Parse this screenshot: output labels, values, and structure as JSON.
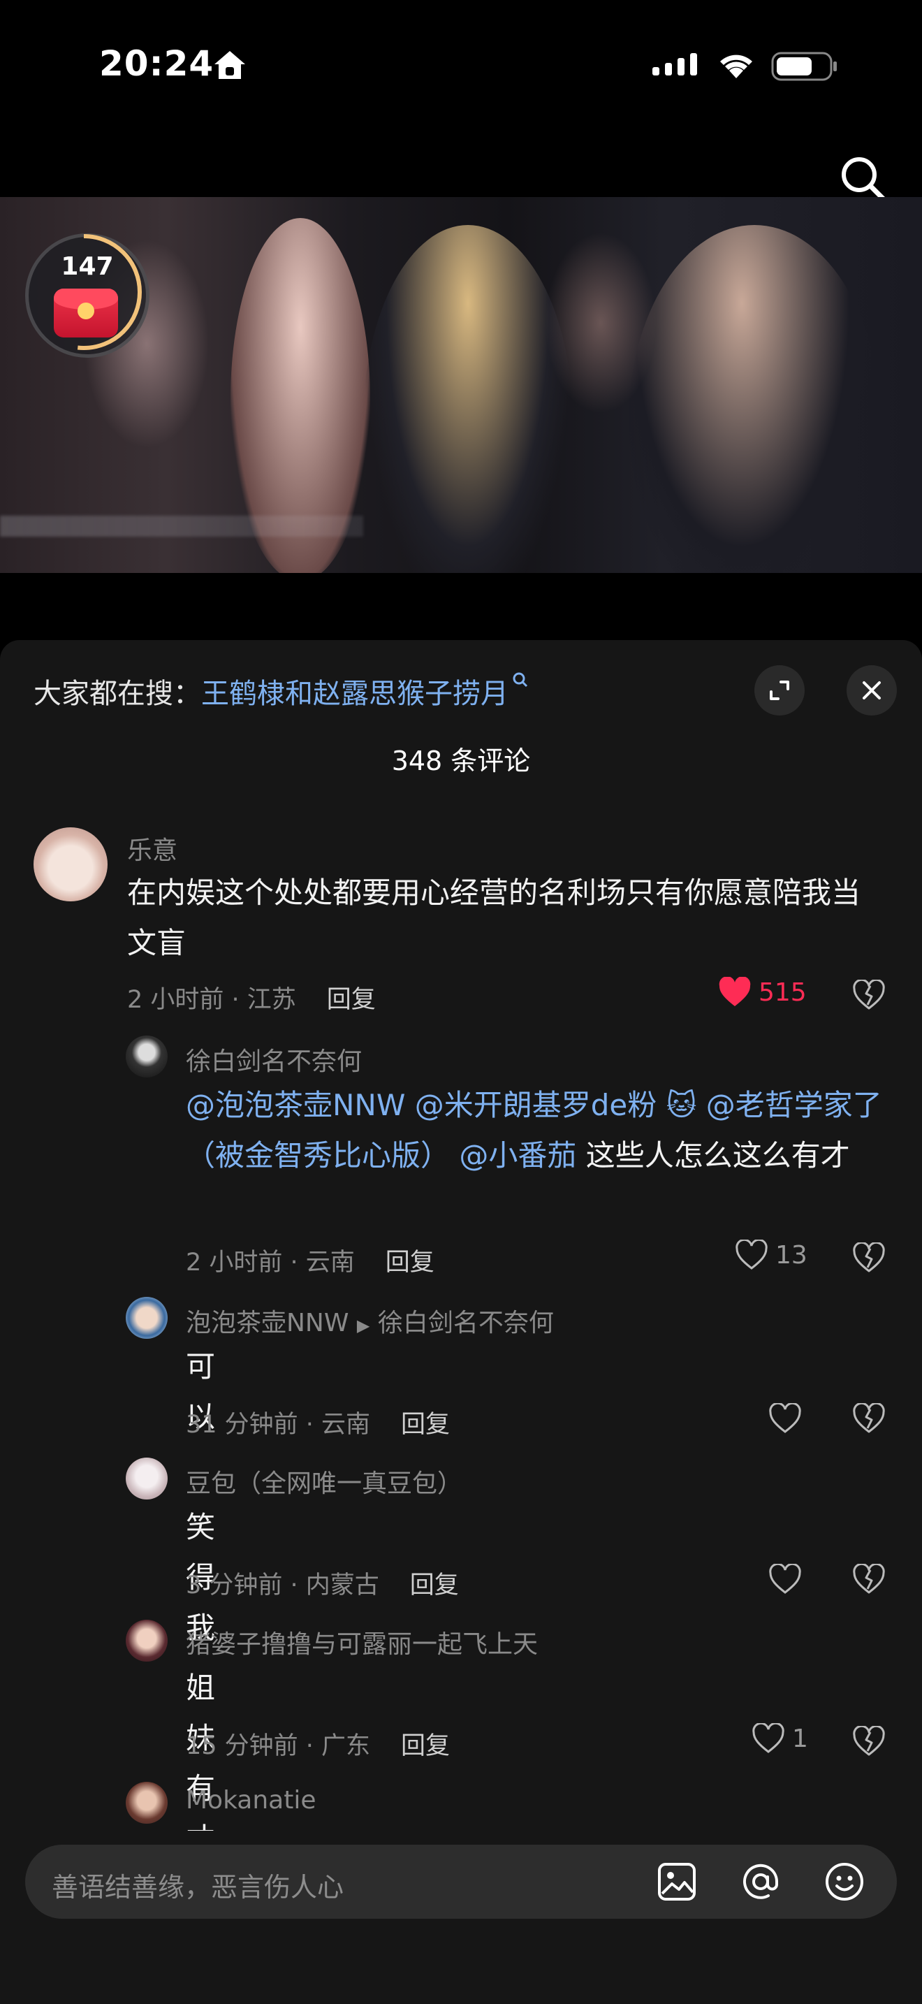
{
  "status_bar": {
    "time": "20:24"
  },
  "video": {
    "red_packet_count": "147"
  },
  "panel": {
    "hot_search_prefix": "大家都在搜：",
    "hot_search_term": "王鹤棣和赵露思猴子捞月",
    "comment_count": "348 条评论"
  },
  "comments": [
    {
      "user": "乐意",
      "text": "在内娱这个处处都要用心经营的名利场只有你愿意陪我当文盲",
      "meta": "2 小时前 · 江苏",
      "reply": "回复",
      "likes": "515"
    },
    {
      "user": "徐白剑名不奈何",
      "mentions": [
        "@泡泡茶壶NNW",
        "@米开朗基罗de粉 🐱",
        "@老哲学家了（被金智秀比心版）",
        "@小番茄"
      ],
      "text_tail": "这些人怎么这么有才",
      "meta": "2 小时前 · 云南",
      "reply": "回复",
      "likes": "13"
    },
    {
      "user": "泡泡茶壶NNW",
      "reply_to": "徐白剑名不奈何",
      "text": "可以",
      "meta": "31 分钟前 · 云南",
      "reply": "回复"
    },
    {
      "user": "豆包（全网唯一真豆包）",
      "text": "笑得我",
      "meta": "3 分钟前 · 内蒙古",
      "reply": "回复"
    },
    {
      "user": "猪婆子撸撸与可露丽一起飞上天",
      "text": "姐妹有才😭😭",
      "meta": "15 分钟前 · 广东",
      "reply": "回复",
      "likes": "1"
    },
    {
      "user": "Mokanatie"
    }
  ],
  "input": {
    "placeholder": "善语结善缘，恶言伤人心"
  },
  "colors": {
    "accent_link": "#7fb1f0",
    "like_red": "#fe2c55",
    "panel_bg": "#161616"
  }
}
